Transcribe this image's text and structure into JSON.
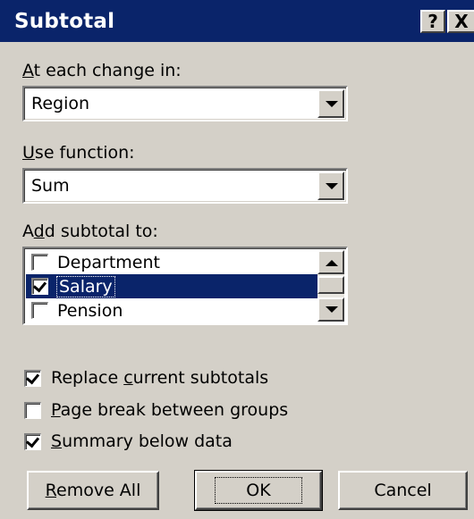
{
  "dialog": {
    "title": "Subtotal",
    "help_glyph": "?",
    "close_glyph": "X"
  },
  "change_in": {
    "label_accel": "A",
    "label_rest": "t each change in:",
    "value": "Region"
  },
  "use_function": {
    "label_accel": "U",
    "label_rest": "se function:",
    "value": "Sum"
  },
  "add_subtotal": {
    "label_pre": "A",
    "label_accel": "d",
    "label_rest": "d subtotal to:",
    "items": [
      {
        "label": "Department",
        "checked": false,
        "selected": false
      },
      {
        "label": "Salary",
        "checked": true,
        "selected": true
      },
      {
        "label": "Pension",
        "checked": false,
        "selected": false
      }
    ]
  },
  "options": {
    "replace": {
      "pre": "Replace ",
      "accel": "c",
      "rest": "urrent subtotals",
      "checked": true
    },
    "page_break": {
      "pre": "",
      "accel": "P",
      "rest": "age break between groups",
      "checked": false
    },
    "summary": {
      "pre": "",
      "accel": "S",
      "rest": "ummary below data",
      "checked": true
    }
  },
  "buttons": {
    "remove_accel": "R",
    "remove_rest": "emove All",
    "ok": "OK",
    "cancel": "Cancel"
  },
  "colors": {
    "titlebar": "#0a246a",
    "face": "#d4d0c8",
    "selection": "#0a246a"
  }
}
